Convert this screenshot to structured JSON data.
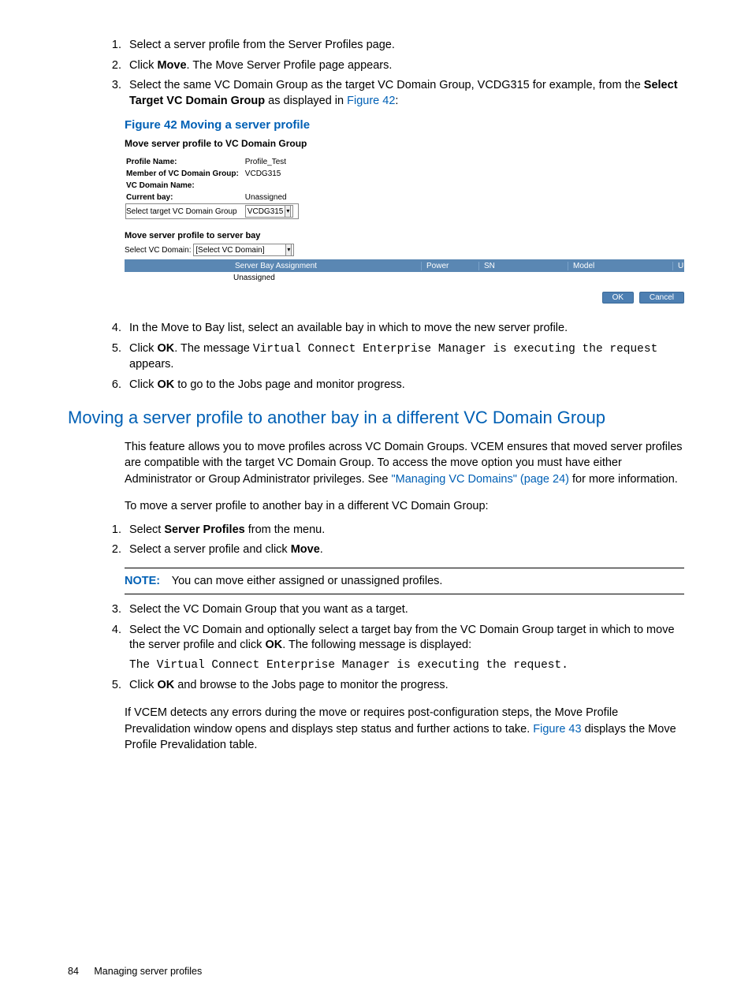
{
  "steps_top": [
    {
      "pre": "Select a server profile from the Server Profiles page."
    },
    {
      "pre": "Click ",
      "bold": "Move",
      "post": ". The Move Server Profile page appears."
    },
    {
      "pre": "Select the same VC Domain Group as the target VC Domain Group, VCDG315 for example, from the ",
      "bold": "Select Target VC Domain Group",
      "post": " as displayed in ",
      "link": "Figure 42",
      "tail": ":"
    }
  ],
  "figure": {
    "caption": "Figure 42 Moving a server profile",
    "title": "Move server profile to VC Domain Group",
    "rows": {
      "profile_name_label": "Profile Name:",
      "profile_name_value": "Profile_Test",
      "member_label": "Member of VC Domain Group:",
      "member_value": "VCDG315",
      "vc_domain_label": "VC Domain Name:",
      "vc_domain_value": "",
      "current_bay_label": "Current bay:",
      "current_bay_value": "Unassigned",
      "select_target_label": "Select target VC Domain Group",
      "select_target_value": "VCDG315"
    },
    "sub_title": "Move server profile to server bay",
    "select_vc_label": "Select VC Domain:",
    "select_vc_value": "[Select VC Domain]",
    "columns": {
      "sba": "Server Bay Assignment",
      "power": "Power",
      "sn": "SN",
      "model": "Model",
      "uid": "UID"
    },
    "row_value": "Unassigned",
    "btn_ok": "OK",
    "btn_cancel": "Cancel"
  },
  "steps_mid": [
    {
      "n": "4",
      "text_pre": "In the Move to Bay list, select an available bay in which to move the new server profile."
    },
    {
      "n": "5",
      "text_pre": "Click ",
      "bold": "OK",
      "text_post": ". The message ",
      "mono": "Virtual Connect Enterprise Manager is executing the request",
      "tail": " appears."
    },
    {
      "n": "6",
      "text_pre": "Click ",
      "bold": "OK",
      "text_post": " to go to the Jobs page and monitor progress."
    }
  ],
  "section_heading": "Moving a server profile to another bay in a different VC Domain Group",
  "para1_pre": "This feature allows you to move profiles across VC Domain Groups. VCEM ensures that moved server profiles are compatible with the target VC Domain Group. To access the move option you must have either Administrator or Group Administrator privileges. See ",
  "para1_link": "\"Managing VC Domains\" (page 24)",
  "para1_post": " for more information.",
  "para2": "To move a server profile to another bay in a different VC Domain Group:",
  "steps_bottom1": [
    {
      "n": "1",
      "pre": "Select ",
      "bold": "Server Profiles",
      "post": " from the menu."
    },
    {
      "n": "2",
      "pre": "Select a server profile and click ",
      "bold": "Move",
      "post": "."
    }
  ],
  "note_label": "NOTE:",
  "note_text": "You can move either assigned or unassigned profiles.",
  "steps_bottom2": [
    {
      "n": "3",
      "text": "Select the VC Domain Group that you want as a target."
    },
    {
      "n": "4",
      "pre": "Select the VC Domain and optionally select a target bay from the VC Domain Group target in which to move the server profile and click ",
      "bold": "OK",
      "post": ". The following message is displayed:",
      "mono": "The Virtual Connect Enterprise Manager is executing the request."
    },
    {
      "n": "5",
      "pre": "Click ",
      "bold": "OK",
      "post": " and browse to the Jobs page to monitor the progress."
    }
  ],
  "para3_pre": "If VCEM detects any errors during the move or requires post-configuration steps, the Move Profile Prevalidation window opens and displays step status and further actions to take. ",
  "para3_link": "Figure 43",
  "para3_post": " displays the Move Profile Prevalidation table.",
  "footer": {
    "page": "84",
    "title": "Managing server profiles"
  }
}
